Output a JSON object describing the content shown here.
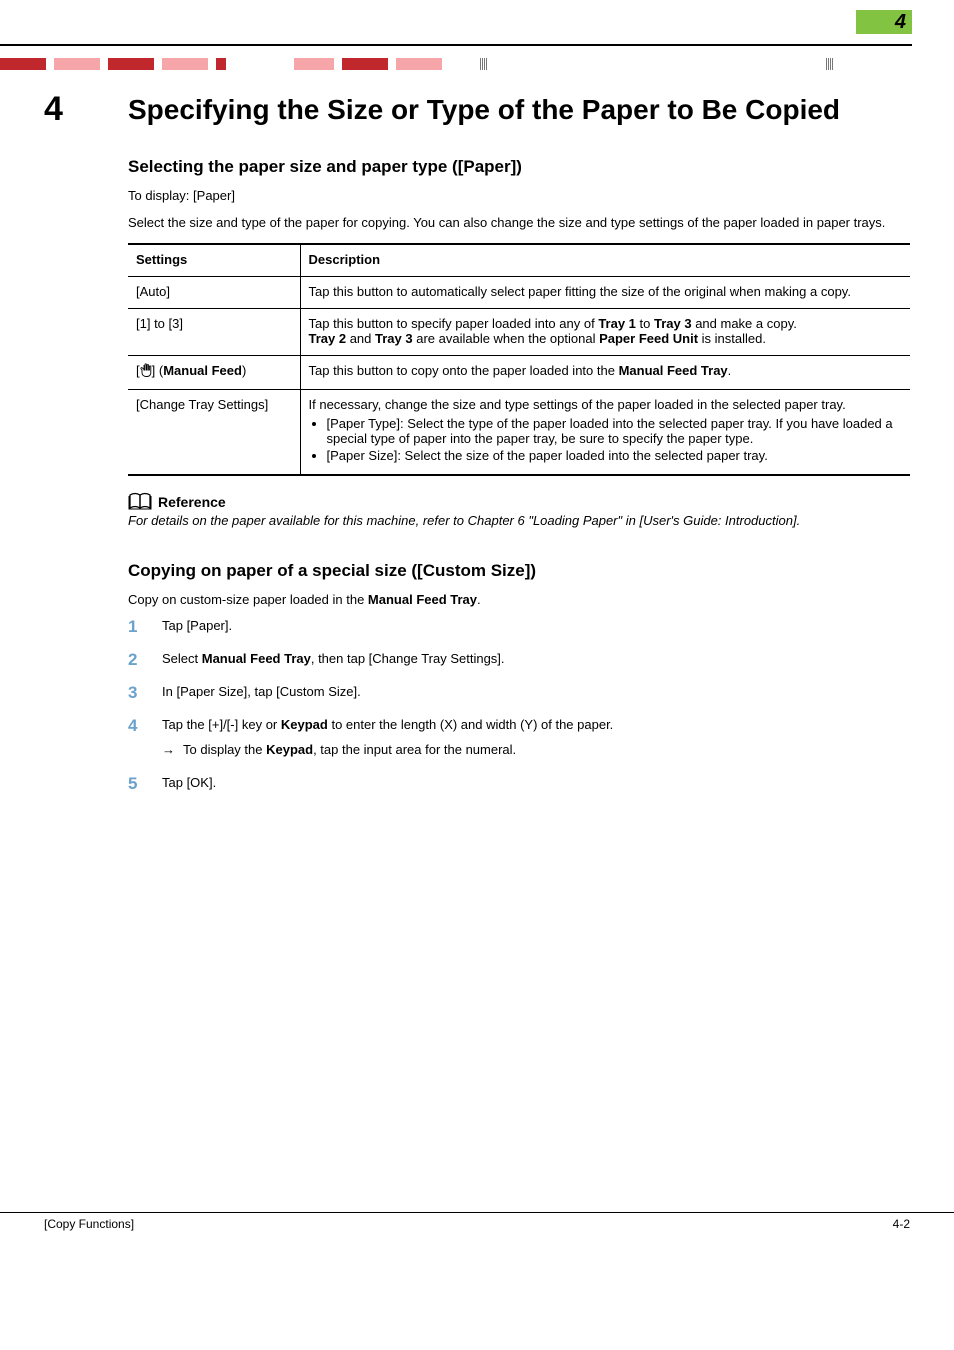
{
  "header": {
    "chapter_badge": "4"
  },
  "title": {
    "chapter_num": "4",
    "text": "Specifying the Size or Type of the Paper to Be Copied"
  },
  "section1": {
    "heading": "Selecting the paper size and paper type ([Paper])",
    "line1": "To display: [Paper]",
    "line2": "Select the size and type of the paper for copying. You can also change the size and type settings of the paper loaded in paper trays.",
    "table": {
      "head": {
        "c1": "Settings",
        "c2": "Description"
      },
      "rows": [
        {
          "c1": "[Auto]",
          "c2_text": "Tap this button to automatically select paper fitting the size of the original when making a copy."
        },
        {
          "c1": "[1] to [3]",
          "c2_text": "Tap this button to specify paper loaded into any of Tray 1 to Tray 3 and make a copy.",
          "c2_text2": "Tray 2 and Tray 3 are available when the optional Paper Feed Unit is installed.",
          "bold": {
            "t1": "Tray 1",
            "t3": "Tray 3",
            "t2": "Tray 2",
            "pfu": "Paper Feed Unit"
          }
        },
        {
          "c1_pre": "[",
          "c1_suf": "] (",
          "c1_bold": "Manual Feed",
          "c1_end": ")",
          "c2_text": "Tap this button to copy onto the paper loaded into the Manual Feed Tray.",
          "bold": {
            "mft": "Manual Feed Tray"
          }
        },
        {
          "c1": "[Change Tray Settings]",
          "c2_text": "If necessary, change the size and type settings of the paper loaded in the selected paper tray.",
          "bullets": [
            "[Paper Type]: Select the type of the paper loaded into the selected paper tray. If you have loaded a special type of paper into the paper tray, be sure to specify the paper type.",
            "[Paper Size]: Select the size of the paper loaded into the selected paper tray."
          ]
        }
      ]
    },
    "reference": {
      "label": "Reference",
      "text": "For details on the paper available for this machine, refer to Chapter 6 \"Loading Paper\" in [User's Guide: Introduction]."
    }
  },
  "section2": {
    "heading": "Copying on paper of a special size ([Custom Size])",
    "intro_pre": "Copy on custom-size paper loaded in the ",
    "intro_bold": "Manual Feed Tray",
    "intro_post": ".",
    "steps": [
      {
        "text": "Tap [Paper]."
      },
      {
        "pre": "Select ",
        "bold": "Manual Feed Tray",
        "post": ", then tap [Change Tray Settings]."
      },
      {
        "text": "In [Paper Size], tap [Custom Size]."
      },
      {
        "pre": "Tap the [+]/[-] key or ",
        "bold": "Keypad",
        "post": " to enter the length (X) and width (Y) of the paper.",
        "sub_pre": "To display the ",
        "sub_bold": "Keypad",
        "sub_post": ", tap the input area for the numeral."
      },
      {
        "text": "Tap [OK]."
      }
    ]
  },
  "footer": {
    "left": "[Copy Functions]",
    "right": "4-2"
  }
}
